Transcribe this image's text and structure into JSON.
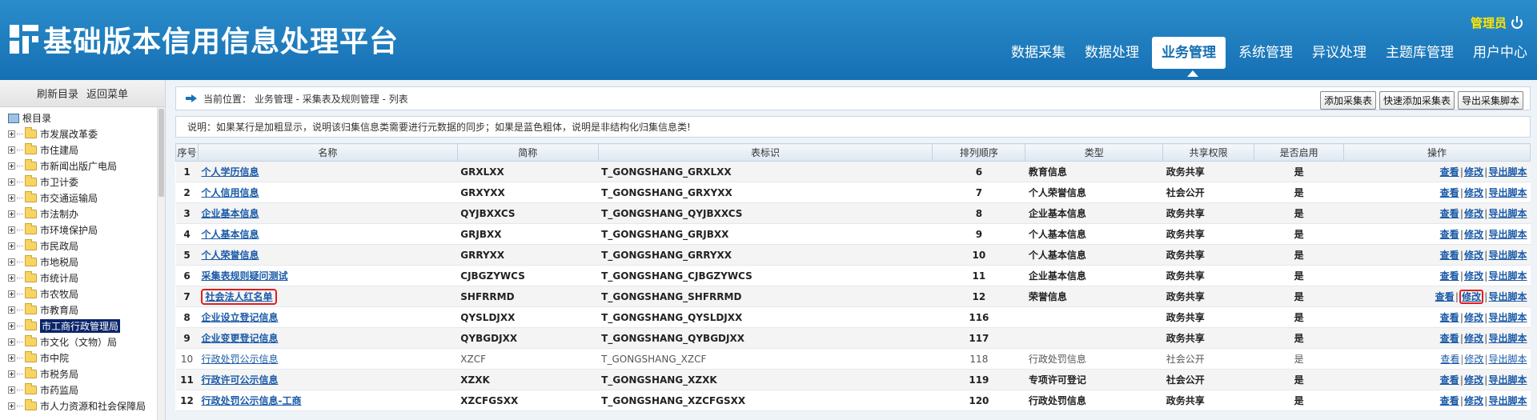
{
  "header": {
    "title": "基础版本信用信息处理平台",
    "user_label": "管理员",
    "nav": [
      {
        "label": "数据采集",
        "active": false
      },
      {
        "label": "数据处理",
        "active": false
      },
      {
        "label": "业务管理",
        "active": true
      },
      {
        "label": "系统管理",
        "active": false
      },
      {
        "label": "异议处理",
        "active": false
      },
      {
        "label": "主题库管理",
        "active": false
      },
      {
        "label": "用户中心",
        "active": false
      }
    ]
  },
  "sidebar": {
    "refresh_label": "刷新目录",
    "back_label": "返回菜单",
    "root_label": "根目录",
    "items": [
      "市发展改革委",
      "市住建局",
      "市新闻出版广电局",
      "市卫计委",
      "市交通运输局",
      "市法制办",
      "市环境保护局",
      "市民政局",
      "市地税局",
      "市统计局",
      "市农牧局",
      "市教育局",
      "市工商行政管理局",
      "市文化（文物）局",
      "市中院",
      "市税务局",
      "市药监局",
      "市人力资源和社会保障局"
    ],
    "selected_index": 12
  },
  "breadcrumb": {
    "text": "当前位置： 业务管理 - 采集表及规则管理 - 列表",
    "buttons": [
      "添加采集表",
      "快速添加采集表",
      "导出采集脚本"
    ]
  },
  "note": "说明：如果某行是加粗显示，说明该归集信息类需要进行元数据的同步；如果是蓝色粗体，说明是非结构化归集信息类!",
  "table": {
    "headers": [
      "序号",
      "名称",
      "简称",
      "表标识",
      "排列顺序",
      "类型",
      "共享权限",
      "是否启用",
      "操作"
    ],
    "op_labels": {
      "view": "查看",
      "edit": "修改",
      "export": "导出脚本"
    },
    "rows": [
      {
        "no": "1",
        "name": "个人学历信息",
        "abbr": "GRXLXX",
        "ident": "T_GONGSHANG_GRXLXX",
        "order": "6",
        "type": "教育信息",
        "share": "政务共享",
        "enabled": "是"
      },
      {
        "no": "2",
        "name": "个人信用信息",
        "abbr": "GRXYXX",
        "ident": "T_GONGSHANG_GRXYXX",
        "order": "7",
        "type": "个人荣誉信息",
        "share": "社会公开",
        "enabled": "是"
      },
      {
        "no": "3",
        "name": "企业基本信息",
        "abbr": "QYJBXXCS",
        "ident": "T_GONGSHANG_QYJBXXCS",
        "order": "8",
        "type": "企业基本信息",
        "share": "政务共享",
        "enabled": "是"
      },
      {
        "no": "4",
        "name": "个人基本信息",
        "abbr": "GRJBXX",
        "ident": "T_GONGSHANG_GRJBXX",
        "order": "9",
        "type": "个人基本信息",
        "share": "政务共享",
        "enabled": "是"
      },
      {
        "no": "5",
        "name": "个人荣誉信息",
        "abbr": "GRRYXX",
        "ident": "T_GONGSHANG_GRRYXX",
        "order": "10",
        "type": "个人基本信息",
        "share": "政务共享",
        "enabled": "是"
      },
      {
        "no": "6",
        "name": "采集表规则疑问测试",
        "abbr": "CJBGZYWCS",
        "ident": "T_GONGSHANG_CJBGZYWCS",
        "order": "11",
        "type": "企业基本信息",
        "share": "政务共享",
        "enabled": "是"
      },
      {
        "no": "7",
        "name": "社会法人红名单",
        "abbr": "SHFRRMD",
        "ident": "T_GONGSHANG_SHFRRMD",
        "order": "12",
        "type": "荣誉信息",
        "share": "政务共享",
        "enabled": "是"
      },
      {
        "no": "8",
        "name": "企业设立登记信息",
        "abbr": "QYSLDJXX",
        "ident": "T_GONGSHANG_QYSLDJXX",
        "order": "116",
        "type": "",
        "share": "政务共享",
        "enabled": "是"
      },
      {
        "no": "9",
        "name": "企业变更登记信息",
        "abbr": "QYBGDJXX",
        "ident": "T_GONGSHANG_QYBGDJXX",
        "order": "117",
        "type": "",
        "share": "政务共享",
        "enabled": "是"
      },
      {
        "no": "10",
        "name": "行政处罚公示信息",
        "abbr": "XZCF",
        "ident": "T_GONGSHANG_XZCF",
        "order": "118",
        "type": "行政处罚信息",
        "share": "社会公开",
        "enabled": "是"
      },
      {
        "no": "11",
        "name": "行政许可公示信息",
        "abbr": "XZXK",
        "ident": "T_GONGSHANG_XZXK",
        "order": "119",
        "type": "专项许可登记",
        "share": "社会公开",
        "enabled": "是"
      },
      {
        "no": "12",
        "name": "行政处罚公示信息-工商",
        "abbr": "XZCFGSXX",
        "ident": "T_GONGSHANG_XZCFGSXX",
        "order": "120",
        "type": "行政处罚信息",
        "share": "政务共享",
        "enabled": "是"
      }
    ]
  }
}
